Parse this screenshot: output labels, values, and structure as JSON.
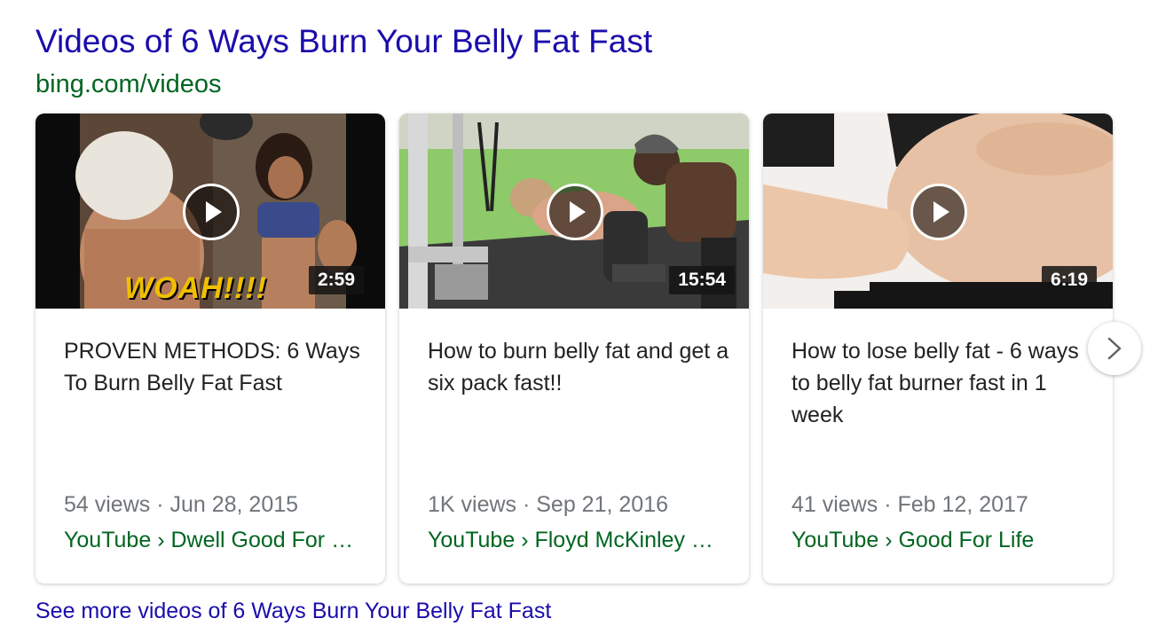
{
  "header": {
    "title": "Videos of 6 Ways Burn Your Belly Fat Fast",
    "source": "bing.com/videos"
  },
  "videos": [
    {
      "duration": "2:59",
      "title": "PROVEN METHODS: 6 Ways To Burn Belly Fat Fast",
      "meta": "54 views · Jun 28, 2015",
      "channel": "YouTube › Dwell Good For …",
      "thumb_caption": "WOAH!!!!"
    },
    {
      "duration": "15:54",
      "title": "How to burn belly fat and get a six pack fast!!",
      "meta": "1K views · Sep 21, 2016",
      "channel": "YouTube › Floyd McKinley …"
    },
    {
      "duration": "6:19",
      "title": "How to lose belly fat - 6 ways to belly fat burner fast in 1 week",
      "meta": "41 views · Feb 12, 2017",
      "channel": "YouTube › Good For Life"
    }
  ],
  "next_icon": "chevron-right-icon",
  "footer": {
    "more_link": "See more videos of 6 Ways Burn Your Belly Fat Fast"
  },
  "colors": {
    "link": "#1a0dab",
    "url_green": "#006621",
    "meta_gray": "#70757a"
  }
}
